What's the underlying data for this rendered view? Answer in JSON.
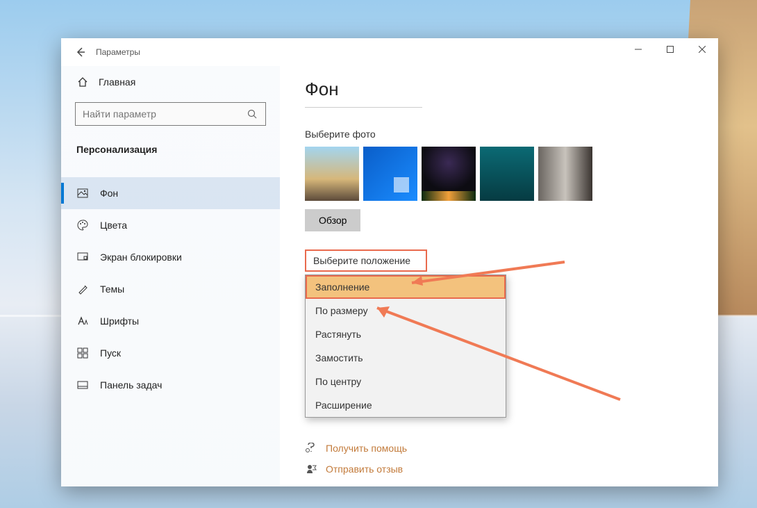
{
  "window": {
    "title": "Параметры"
  },
  "sidebar": {
    "home": "Главная",
    "search_placeholder": "Найти параметр",
    "category_title": "Персонализация",
    "items": [
      {
        "label": "Фон"
      },
      {
        "label": "Цвета"
      },
      {
        "label": "Экран блокировки"
      },
      {
        "label": "Темы"
      },
      {
        "label": "Шрифты"
      },
      {
        "label": "Пуск"
      },
      {
        "label": "Панель задач"
      }
    ]
  },
  "content": {
    "page_title": "Фон",
    "choose_photo_label": "Выберите фото",
    "browse_label": "Обзор",
    "position_label": "Выберите положение",
    "position_options": [
      "Заполнение",
      "По размеру",
      "Растянуть",
      "Замостить",
      "По центру",
      "Расширение"
    ],
    "help_link": "Получить помощь",
    "feedback_link": "Отправить отзыв"
  }
}
